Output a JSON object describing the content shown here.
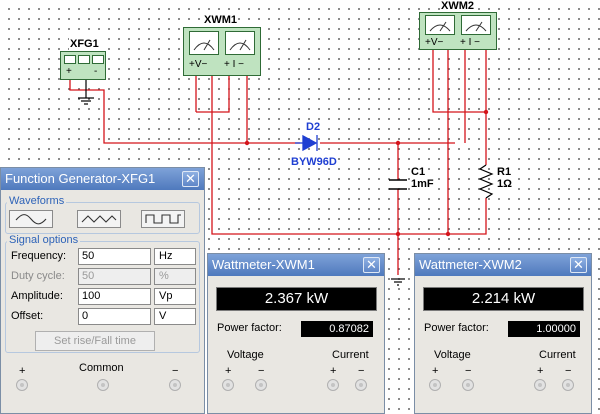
{
  "schematic": {
    "function_generator_label": "XFG1",
    "wattmeter1_label": "XWM1",
    "wattmeter2_label": "XWM2",
    "wattmeter_voltage_terminal": "+V−",
    "wattmeter_current_terminal": "+ I −",
    "diode": {
      "ref": "D2",
      "part": "BYW96D"
    },
    "capacitor": {
      "ref": "C1",
      "value": "1mF"
    },
    "resistor": {
      "ref": "R1",
      "value": "1Ω"
    },
    "fg_terminals": [
      "+",
      "-"
    ],
    "wire_color": "#d4141b",
    "component_color": "#1f3fd2"
  },
  "function_generator": {
    "title": "Function Generator-XFG1",
    "close_glyph": "✕",
    "waveforms_title": "Waveforms",
    "signal_options_title": "Signal options",
    "fields": [
      {
        "label": "Frequency:",
        "value": "50",
        "unit": "Hz"
      },
      {
        "label": "Duty cycle:",
        "value": "50",
        "unit": "%"
      },
      {
        "label": "Amplitude:",
        "value": "100",
        "unit": "Vp"
      },
      {
        "label": "Offset:",
        "value": "0",
        "unit": "V"
      }
    ],
    "rise_fall_button": "Set rise/Fall time",
    "terminal_plus": "+",
    "terminal_common": "Common",
    "terminal_minus": "−"
  },
  "wattmeter1": {
    "title": "Wattmeter-XWM1",
    "close_glyph": "✕",
    "reading": "2.367 kW",
    "power_factor_label": "Power factor:",
    "power_factor": "0.87082",
    "voltage_label": "Voltage",
    "current_label": "Current",
    "plus": "+",
    "minus": "−"
  },
  "wattmeter2": {
    "title": "Wattmeter-XWM2",
    "close_glyph": "✕",
    "reading": "2.214 kW",
    "power_factor_label": "Power factor:",
    "power_factor": "1.00000",
    "voltage_label": "Voltage",
    "current_label": "Current",
    "plus": "+",
    "minus": "−"
  }
}
